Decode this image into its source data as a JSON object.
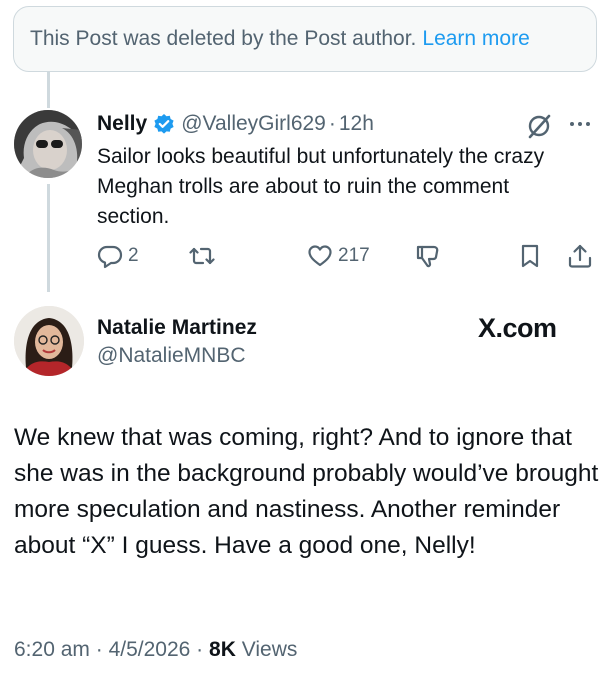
{
  "deleted_notice": {
    "text": "This Post was deleted by the Post author.",
    "link": "Learn more"
  },
  "reply": {
    "name": "Nelly",
    "handle": "@ValleyGirl629",
    "separator": "·",
    "time": "12h",
    "text": "Sailor looks beautiful but unfortunately the crazy Meghan trolls are about to ruin the comment section.",
    "icons": [
      "verified-badge",
      "grok-icon",
      "more-icon"
    ],
    "actions": {
      "replies": "2",
      "reposts": "",
      "likes": "217"
    }
  },
  "main_post": {
    "name": "Natalie Martinez",
    "handle": "@NatalieMNBC",
    "watermark": "X.com",
    "text": "We knew that was coming, right?  And to ignore that she was in the background  probably would’ve brought more speculation and nastiness. Another reminder about “X” I guess. Have a good one, Nelly!",
    "time": "6:20 am",
    "sep1": "·",
    "date": "4/5/2026",
    "sep2": "·",
    "views_count": "8K",
    "views_label": "Views"
  },
  "colors": {
    "accent": "#1d9bf0",
    "secondary_text": "#536471",
    "primary_text": "#0f1419",
    "border": "#cfd9de"
  }
}
